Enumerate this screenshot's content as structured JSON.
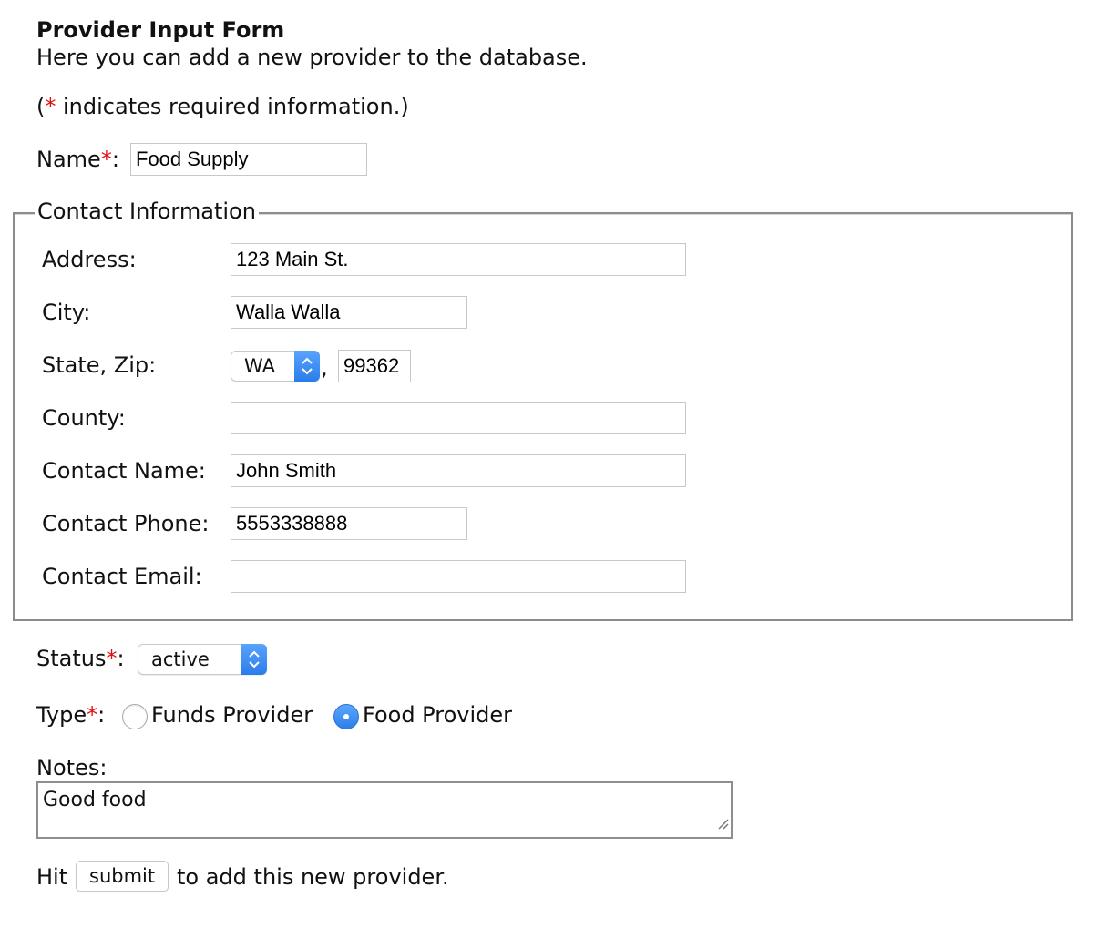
{
  "form": {
    "title": "Provider Input Form",
    "intro": "Here you can add a new provider to the database.",
    "required_note": {
      "open": "(",
      "star": "*",
      "text": " indicates required information.)"
    },
    "name": {
      "label": "Name",
      "star": "*",
      "colon": ":",
      "value": "Food Supply"
    },
    "contact": {
      "legend": "Contact Information",
      "address": {
        "label": "Address:",
        "value": "123 Main St."
      },
      "city": {
        "label": "City:",
        "value": "Walla Walla"
      },
      "state_zip": {
        "label": "State, Zip:",
        "state": "WA",
        "separator": ",",
        "zip": "99362"
      },
      "county": {
        "label": "County:",
        "value": ""
      },
      "contact_name": {
        "label": "Contact Name:",
        "value": "John Smith"
      },
      "contact_phone": {
        "label": "Contact Phone:",
        "value": "5553338888"
      },
      "contact_email": {
        "label": "Contact Email:",
        "value": ""
      }
    },
    "status": {
      "label": "Status",
      "star": "*",
      "colon": ":",
      "value": "active"
    },
    "type": {
      "label": "Type",
      "star": "*",
      "colon": ":",
      "options": [
        {
          "label": "Funds Provider",
          "selected": false
        },
        {
          "label": "Food Provider",
          "selected": true
        }
      ]
    },
    "notes": {
      "label": "Notes:",
      "value": "Good food"
    },
    "submit": {
      "before": "Hit",
      "button": "submit",
      "after": "to add this new provider."
    }
  },
  "colors": {
    "required": "#e01010",
    "accent": "#2c7fe8"
  }
}
